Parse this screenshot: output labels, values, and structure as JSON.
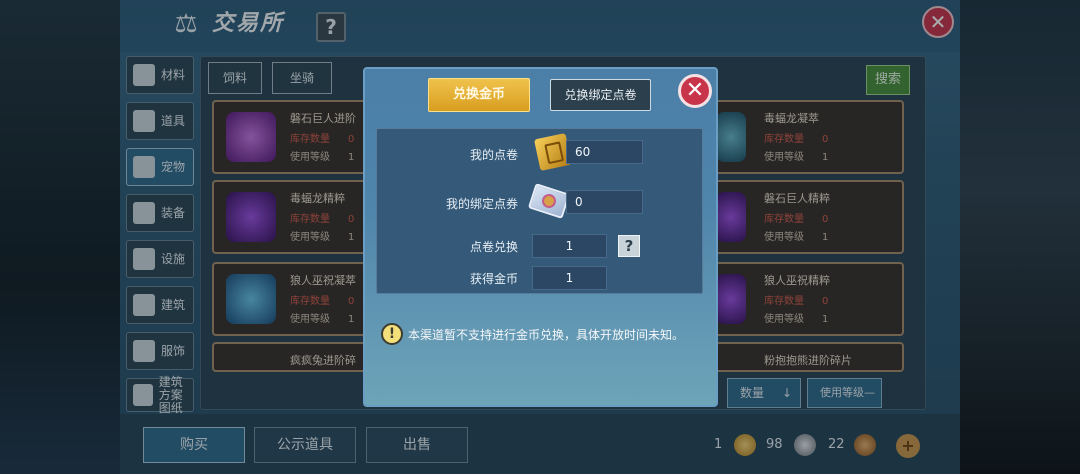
{
  "window": {
    "title": "交易所"
  },
  "sidebar": {
    "items": [
      {
        "label": "材料"
      },
      {
        "label": "道具"
      },
      {
        "label": "宠物"
      },
      {
        "label": "装备"
      },
      {
        "label": "设施"
      },
      {
        "label": "建筑"
      },
      {
        "label": "服饰"
      },
      {
        "label": "建筑方案图纸"
      }
    ],
    "active_index": 2
  },
  "filters": {
    "tabs": [
      "饲料",
      "坐骑"
    ],
    "search_label": "搜索"
  },
  "items": [
    {
      "name": "磐石巨人进阶",
      "stock_label": "库存数量",
      "stock_value": "0",
      "level_label": "使用等级",
      "level_value": "1"
    },
    {
      "name": "毒蝠龙凝萃",
      "stock_label": "库存数量",
      "stock_value": "0",
      "level_label": "使用等级",
      "level_value": "1"
    },
    {
      "name": "毒蝠龙精粹",
      "stock_label": "库存数量",
      "stock_value": "0",
      "level_label": "使用等级",
      "level_value": "1"
    },
    {
      "name": "磐石巨人精粹",
      "stock_label": "库存数量",
      "stock_value": "0",
      "level_label": "使用等级",
      "level_value": "1"
    },
    {
      "name": "狼人巫祝凝萃",
      "stock_label": "库存数量",
      "stock_value": "0",
      "level_label": "使用等级",
      "level_value": "1"
    },
    {
      "name": "狼人巫祝精粹",
      "stock_label": "库存数量",
      "stock_value": "0",
      "level_label": "使用等级",
      "level_value": "1"
    },
    {
      "name": "疯疯兔进阶碎",
      "stock_label": "",
      "stock_value": "",
      "level_label": "",
      "level_value": ""
    },
    {
      "name": "粉抱抱熊进阶碎片",
      "stock_label": "",
      "stock_value": "",
      "level_label": "",
      "level_value": ""
    }
  ],
  "sort": {
    "quantity_label": "数量",
    "level_label": "使用等级"
  },
  "bottom_tabs": {
    "buy": "购买",
    "public": "公示道具",
    "sell": "出售"
  },
  "currencies": {
    "gold": "1",
    "silver": "98",
    "copper": "22"
  },
  "modal": {
    "tab_exchange_gold": "兑换金币",
    "tab_exchange_bound": "兑换绑定点卷",
    "my_coupon_label": "我的点卷",
    "my_coupon_value": "60",
    "my_bound_label": "我的绑定点券",
    "my_bound_value": "0",
    "exchange_label": "点卷兑换",
    "exchange_value": "1",
    "gain_label": "获得金币",
    "gain_value": "1",
    "notice": "本渠道暂不支持进行金币兑换，具体开放时间未知。"
  },
  "colors": {
    "accent_gold": "#f0c24b",
    "close_red": "#c8354a",
    "panel_blue": "#4b7fa8"
  }
}
